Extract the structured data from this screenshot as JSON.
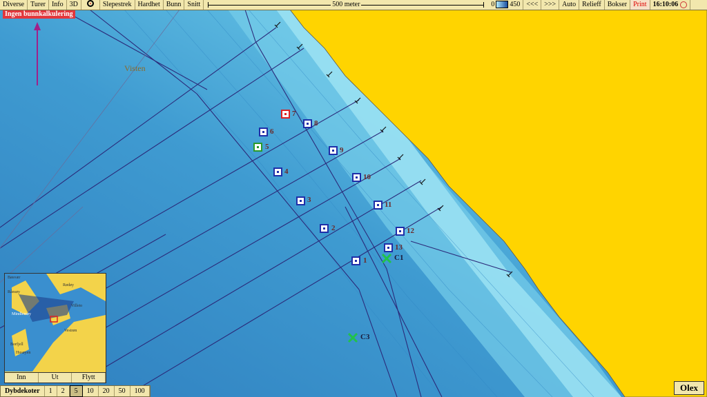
{
  "toolbar": {
    "menus": [
      "Diverse",
      "Turer",
      "Info",
      "3D"
    ],
    "menus2": [
      "Slepestrek",
      "Hardhet",
      "Bunn",
      "Snitt"
    ],
    "scale_label": "500 meter",
    "depth_min": "0",
    "depth_max": "450",
    "prev": "<<<",
    "next": ">>>",
    "auto": "Auto",
    "relief": "Relieff",
    "boxes": "Bokser",
    "print": "Print",
    "clock": "16:10:06"
  },
  "status": "Ingen bunnkalkulering",
  "place_name": "Visten",
  "markers": [
    "1",
    "2",
    "3",
    "4",
    "5",
    "6",
    "7",
    "8",
    "9",
    "10",
    "11",
    "12",
    "13"
  ],
  "crosses": [
    "C1",
    "C3"
  ],
  "minimap": {
    "labels": [
      "Bøsvær",
      "Rødøy",
      "Rånsøy",
      "Mindlemøy",
      "Villeto",
      "Vestrøn",
      "Borfjell",
      "Husøyen"
    ],
    "buttons": [
      "Inn",
      "Ut",
      "Flytt"
    ]
  },
  "depth_contours": {
    "label": "Dybdekoter",
    "options": [
      "1",
      "2",
      "5",
      "10",
      "20",
      "50",
      "100"
    ],
    "selected": "5"
  },
  "brand": "Olex",
  "colors": {
    "land": "#ffd400",
    "deep": "#3b8ec9",
    "shallow": "#9fe6f5",
    "track": "#2b2a7a",
    "marker": "#1e2ea8",
    "marker_active": "#d22",
    "marker_green": "#2a9a2a",
    "cross": "#21c24a"
  }
}
